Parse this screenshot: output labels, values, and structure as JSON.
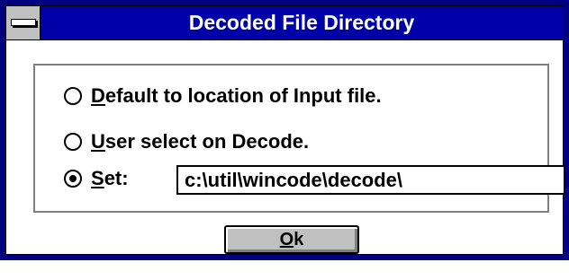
{
  "window": {
    "title": "Decoded File Directory"
  },
  "options": [
    {
      "access_key": "D",
      "label_rest": "efault to location of Input file.",
      "selected": false
    },
    {
      "access_key": "U",
      "label_rest": "ser select on Decode.",
      "selected": false
    },
    {
      "access_key": "S",
      "label_rest": "et:",
      "selected": true
    }
  ],
  "path_field": {
    "value": "c:\\util\\wincode\\decode\\"
  },
  "ok_button": {
    "access_key": "O",
    "label_rest": "k"
  },
  "colors": {
    "title_bar": "#0000a8",
    "frame": "#000080",
    "button_face": "#c0c0c0"
  }
}
